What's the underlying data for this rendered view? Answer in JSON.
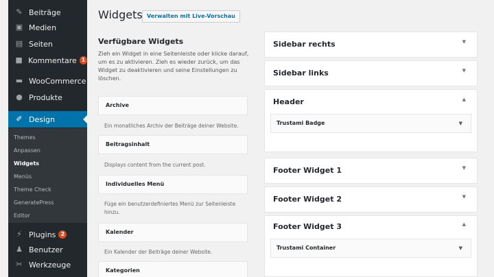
{
  "sidebar": {
    "items": [
      {
        "label": "Beiträge",
        "icon": "pin-icon"
      },
      {
        "label": "Medien",
        "icon": "media-icon"
      },
      {
        "label": "Seiten",
        "icon": "pages-icon"
      },
      {
        "label": "Kommentare",
        "icon": "comments-icon",
        "badge": "1"
      },
      {
        "label": "WooCommerce",
        "icon": "woocommerce-icon"
      },
      {
        "label": "Produkte",
        "icon": "products-icon"
      },
      {
        "label": "Design",
        "icon": "brush-icon"
      },
      {
        "label": "Plugins",
        "icon": "plugins-icon",
        "badge": "2"
      },
      {
        "label": "Benutzer",
        "icon": "users-icon"
      },
      {
        "label": "Werkzeuge",
        "icon": "tools-icon"
      }
    ],
    "submenu": [
      "Themes",
      "Anpassen",
      "Widgets",
      "Menüs",
      "Theme Check",
      "GeneratePress",
      "Editor"
    ],
    "current_submenu": "Widgets"
  },
  "header": {
    "title": "Widgets",
    "live_preview_button": "Verwalten mit Live-Vorschau"
  },
  "available": {
    "title": "Verfügbare Widgets",
    "description": "Zieh ein Widget in eine Seitenleiste oder klicke darauf, um es zu aktivieren. Zieh es wieder zurück, um das Widget zu deaktivieren und seine Einstellungen zu löschen.",
    "widgets": [
      {
        "name": "Archive",
        "desc": "Ein monatliches Archiv der Beiträge deiner Website."
      },
      {
        "name": "Beitragsinhalt",
        "desc": "Displays content from the current post."
      },
      {
        "name": "Individuelles Menü",
        "desc": "Füge ein benutzerdefiniertes Menü zur Seitenleiste hinzu."
      },
      {
        "name": "Kalender",
        "desc": "Ein Kalender der Beiträge deiner Website."
      },
      {
        "name": "Kategorien",
        "desc": ""
      }
    ]
  },
  "areas": [
    {
      "title": "Sidebar rechts",
      "arrow": "▼"
    },
    {
      "title": "Sidebar links",
      "arrow": "▼"
    },
    {
      "title": "Header",
      "arrow": "▲",
      "widget": "Trustami Badge",
      "widget_arrow": "▼"
    },
    {
      "title": "Footer Widget 1",
      "arrow": "▼"
    },
    {
      "title": "Footer Widget 2",
      "arrow": "▼"
    },
    {
      "title": "Footer Widget 3",
      "arrow": "▲",
      "widget": "Trustami Container",
      "widget_arrow": "▼"
    }
  ],
  "colors": {
    "sidebar_bg": "#23282d",
    "active_bg": "#0073aa",
    "badge_bg": "#d54e21"
  }
}
